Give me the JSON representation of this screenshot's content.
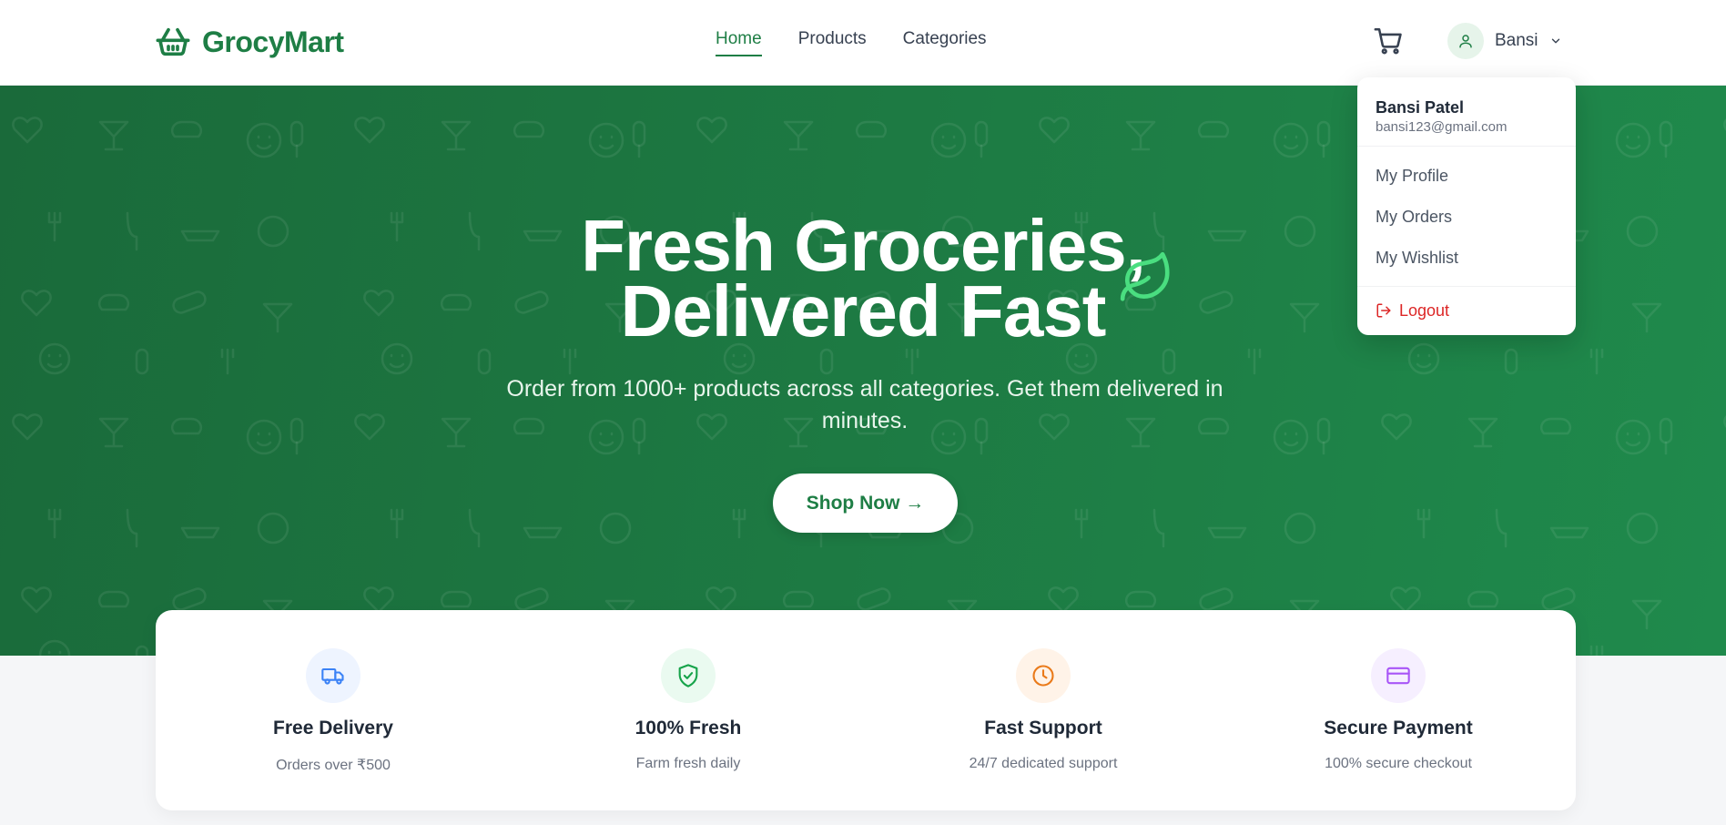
{
  "header": {
    "brand": "GrocyMart",
    "nav": [
      {
        "label": "Home",
        "active": true
      },
      {
        "label": "Products",
        "active": false
      },
      {
        "label": "Categories",
        "active": false
      }
    ],
    "cart_icon": "shopping-cart-icon",
    "user": {
      "short_name": "Bansi",
      "avatar_icon": "user-icon",
      "chevron_icon": "chevron-down-icon"
    }
  },
  "dropdown": {
    "full_name": "Bansi Patel",
    "email": "bansi123@gmail.com",
    "items": [
      {
        "label": "My Profile"
      },
      {
        "label": "My Orders"
      },
      {
        "label": "My Wishlist"
      }
    ],
    "logout": {
      "label": "Logout",
      "icon": "logout-icon",
      "color": "#dc2626"
    }
  },
  "hero": {
    "title_line1": "Fresh Groceries,",
    "title_line2": "Delivered Fast",
    "subtitle": "Order from 1000+ products across all categories. Get them delivered in minutes.",
    "cta": "Shop Now →",
    "leaf_icon": "leaf-icon"
  },
  "features": [
    {
      "title": "Free Delivery",
      "desc": "Orders over ₹500",
      "icon": "truck-icon",
      "color": "#3b82f6",
      "bg": "#eef4ff"
    },
    {
      "title": "100% Fresh",
      "desc": "Farm fresh daily",
      "icon": "shield-check-icon",
      "color": "#16a34a",
      "bg": "#eafaf0"
    },
    {
      "title": "Fast Support",
      "desc": "24/7 dedicated support",
      "icon": "clock-icon",
      "color": "#ea7a1a",
      "bg": "#fff3e8"
    },
    {
      "title": "Secure Payment",
      "desc": "100% secure checkout",
      "icon": "credit-card-icon",
      "color": "#a855f7",
      "bg": "#f6efff"
    }
  ],
  "colors": {
    "brand": "#1e7e45",
    "hero_start": "#1a6a3a",
    "hero_end": "#1f8a4c"
  }
}
